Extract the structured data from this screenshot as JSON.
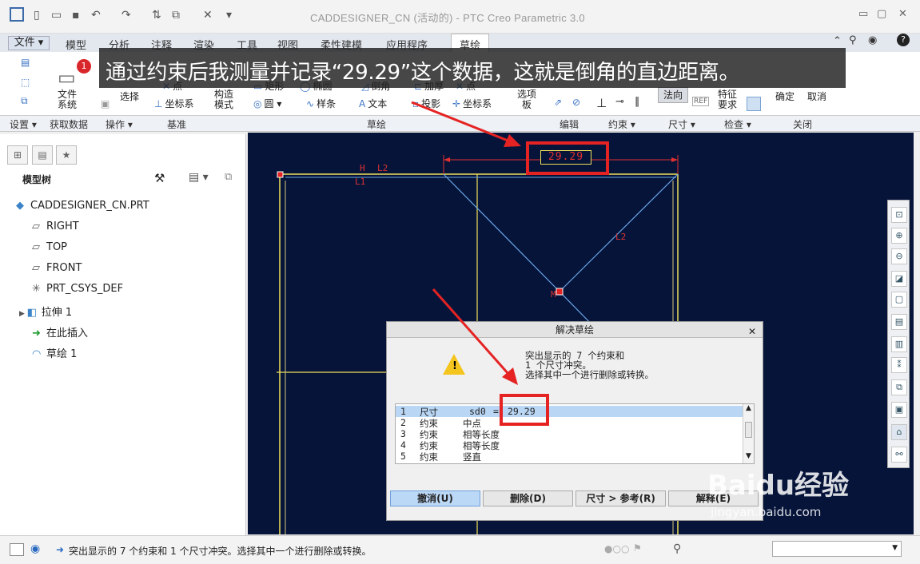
{
  "window": {
    "title": "CADDESIGNER_CN (活动的) - PTC Creo Parametric 3.0"
  },
  "tabs": [
    "文件",
    "模型",
    "分析",
    "注释",
    "渲染",
    "工具",
    "视图",
    "柔性建模",
    "应用程序",
    "草绘"
  ],
  "ribbon": {
    "file_system": "文件\n系统",
    "select": "选择",
    "coord_sys": "坐标系",
    "construct": "构造\n模式",
    "rect": "矩形",
    "ellipse": "椭圆",
    "point": "点",
    "chamfer": "倒角",
    "thicken": "加厚",
    "circle": "圆",
    "spline": "样条",
    "text": "文本",
    "project": "投影",
    "coord_sys2": "坐标系",
    "palette": "选项\n板",
    "normal": "法向",
    "feature_req": "特征\n要求",
    "ok": "确定",
    "cancel": "取消"
  },
  "groups": [
    "设置",
    "获取数据",
    "操作",
    "基准",
    "草绘",
    "编辑",
    "约束",
    "尺寸",
    "检查",
    "关闭"
  ],
  "sidebar": {
    "title": "模型树",
    "items": [
      {
        "label": "CADDESIGNER_CN.PRT",
        "icon": "part-icon"
      },
      {
        "label": "RIGHT",
        "icon": "plane-icon"
      },
      {
        "label": "TOP",
        "icon": "plane-icon"
      },
      {
        "label": "FRONT",
        "icon": "plane-icon"
      },
      {
        "label": "PRT_CSYS_DEF",
        "icon": "csys-icon"
      },
      {
        "label": "拉伸 1",
        "icon": "extrude-icon"
      },
      {
        "label": "在此插入",
        "icon": "insert-arrow-icon"
      },
      {
        "label": "草绘 1",
        "icon": "sketch-icon"
      }
    ]
  },
  "caption": "通过约束后我测量并记录“29.29”这个数据，这就是倒角的直边距离。",
  "notification_count": "1",
  "canvas": {
    "dimension": "29.29",
    "labels": [
      "H",
      "L2",
      "L1",
      "L2",
      "M"
    ]
  },
  "dialog": {
    "title": "解决草绘",
    "message": [
      "突出显示的 7 个约束和",
      " 1 个尺寸冲突。",
      "选择其中一个进行删除或转换。"
    ],
    "rows": [
      {
        "n": "1",
        "type": "尺寸",
        "name": "sd0",
        "eq": "=",
        "value": "29.29"
      },
      {
        "n": "2",
        "type": "约束",
        "name": "中点",
        "eq": "",
        "value": ""
      },
      {
        "n": "3",
        "type": "约束",
        "name": "相等长度",
        "eq": "",
        "value": ""
      },
      {
        "n": "4",
        "type": "约束",
        "name": "相等长度",
        "eq": "",
        "value": ""
      },
      {
        "n": "5",
        "type": "约束",
        "name": "竖直",
        "eq": "",
        "value": ""
      }
    ],
    "buttons": [
      "撤消(U)",
      "删除(D)",
      "尺寸 > 参考(R)",
      "解释(E)"
    ]
  },
  "status": {
    "message": "突出显示的 7 个约束和 1 个尺寸冲突。选择其中一个进行删除或转换。"
  },
  "watermark": {
    "brand": "Baidu经验",
    "url": "jingyan.baidu.com"
  },
  "colors": {
    "canvas_bg": "#06143a",
    "highlight": "#e52323",
    "sketch_line": "#f0e05a",
    "construct_line": "#6aa6e8"
  }
}
